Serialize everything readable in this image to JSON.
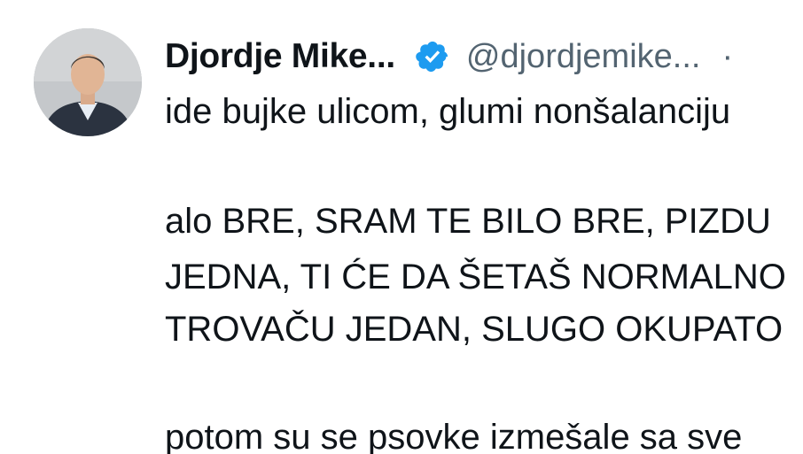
{
  "author": {
    "display_name": "Djordje Mike...",
    "handle": "@djordjemike...",
    "separator": "·",
    "verified": true,
    "verified_badge_color": "#1d9bf0"
  },
  "tweet": {
    "lines": [
      "ide bujke ulicom, glumi nonšalanciju",
      "alo BRE, SRAM TE BILO BRE, PIZDU",
      "JEDNA, TI ĆE DA ŠETAŠ NORMALNO",
      "TROVAČU JEDAN, SLUGO OKUPATO",
      "potom su se psovke izmešale sa sve"
    ]
  },
  "colors": {
    "text_primary": "#0f1419",
    "text_secondary": "#536471",
    "background": "#ffffff"
  }
}
